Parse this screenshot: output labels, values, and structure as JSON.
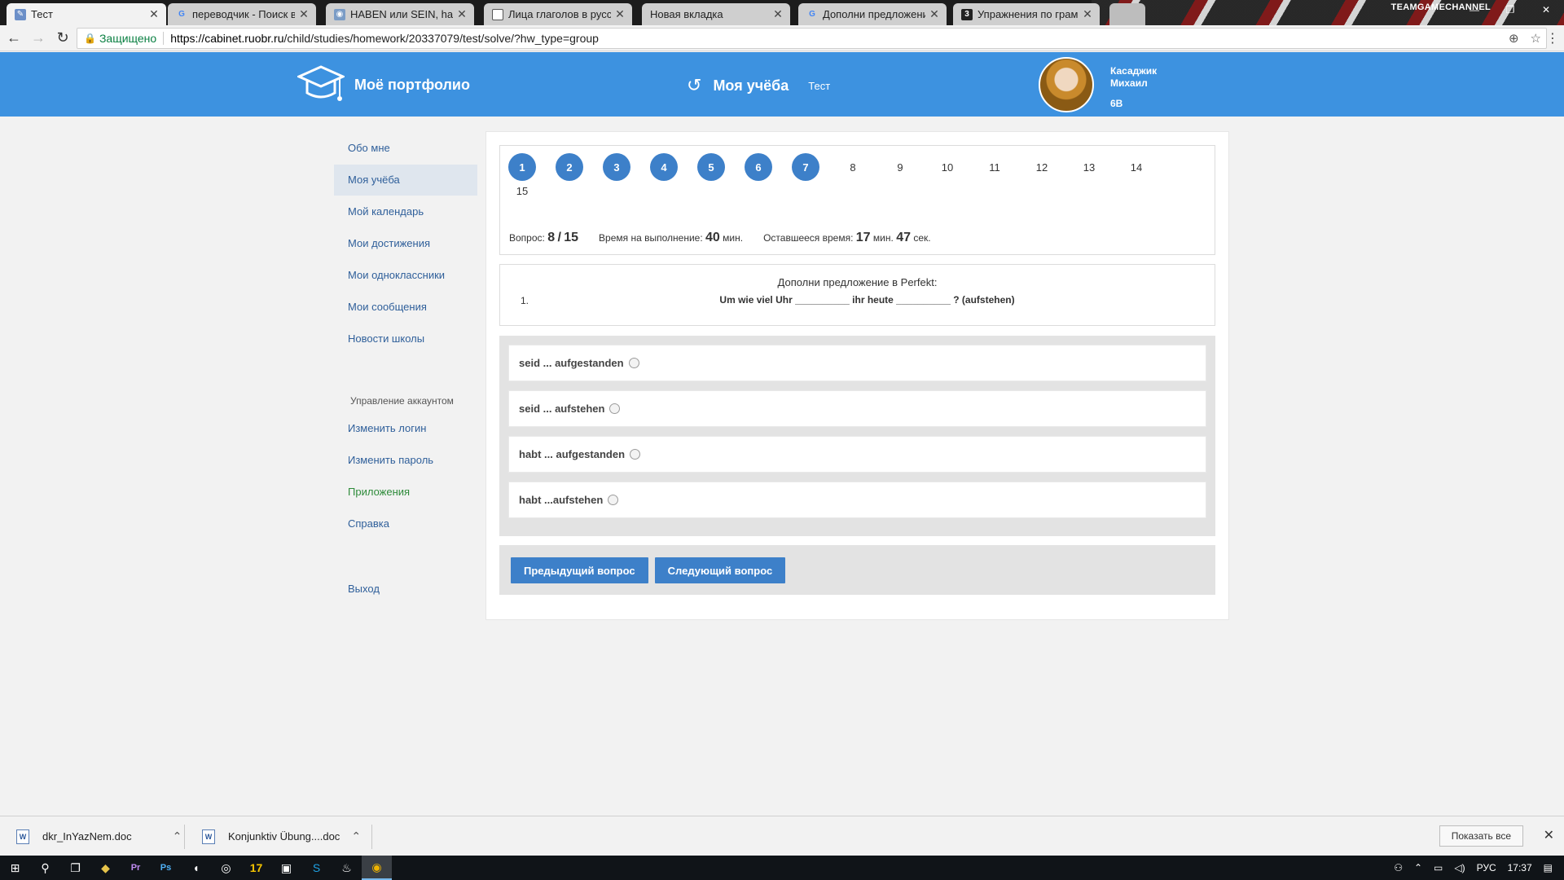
{
  "browser": {
    "tabs": [
      {
        "label": "Тест",
        "icon": "site-icon",
        "active": true
      },
      {
        "label": "переводчик - Поиск в G",
        "icon": "google-icon"
      },
      {
        "label": "HABEN или SEIN, haben",
        "icon": "site-icon"
      },
      {
        "label": "Лица глаголов в русско",
        "icon": "page-icon"
      },
      {
        "label": "Новая вкладка",
        "icon": "none"
      },
      {
        "label": "Дополни предложение",
        "icon": "google-icon"
      },
      {
        "label": "Упражнения по грамма",
        "icon": "site-icon"
      }
    ],
    "window_title": "TEAMGAMECHANNEL",
    "secure_label": "Защищено",
    "url_host": "https://cabinet.ruobr.ru",
    "url_path": "/child/studies/homework/20337079/test/solve/?hw_type=group"
  },
  "header": {
    "logo_text": "Моё портфолио",
    "section": "Моя учёба",
    "subsection": "Тест",
    "user_first": "Касаджик",
    "user_last": "Михаил",
    "user_class": "6В"
  },
  "sidebar": {
    "items": [
      "Обо мне",
      "Моя учёба",
      "Мой календарь",
      "Мои достижения",
      "Мои одноклассники",
      "Мои сообщения",
      "Новости школы"
    ],
    "account_caption": "Управление аккаунтом",
    "account_items": [
      "Изменить логин",
      "Изменить пароль",
      "Приложения",
      "Справка"
    ],
    "exit": "Выход"
  },
  "quiz": {
    "questions": [
      "1",
      "2",
      "3",
      "4",
      "5",
      "6",
      "7",
      "8",
      "9",
      "10",
      "11",
      "12",
      "13",
      "14",
      "15"
    ],
    "answered_count": 7,
    "question_label": "Вопрос:",
    "question_current": "8",
    "question_total": "15",
    "time_label": "Время на выполнение:",
    "time_value": "40",
    "min_label": "мин.",
    "remaining_label": "Оставшееся время:",
    "remaining_min": "17",
    "remaining_sec": "47",
    "sec_label": "сек.",
    "instruction": "Дополни предложение в Perfekt:",
    "item_number": "1.",
    "sentence": "Um wie viel Uhr __________ ihr heute __________ ? (aufstehen)",
    "answers": [
      "seid ... aufgestanden",
      "seid ... aufstehen",
      "habt ... aufgestanden",
      "habt ...aufstehen"
    ],
    "prev_button": "Предыдущий вопрос",
    "next_button": "Следующий вопрос"
  },
  "downloads": {
    "files": [
      "dkr_InYazNem.doc",
      "Konjunktiv Übung....doc"
    ],
    "show_all": "Показать все"
  },
  "taskbar": {
    "lang": "РУС",
    "time": "17:37"
  },
  "colors": {
    "header_blue": "#3d92e0",
    "button_blue": "#3d80c9",
    "link_blue": "#2f5f9a",
    "link_green": "#2e8b3a"
  }
}
